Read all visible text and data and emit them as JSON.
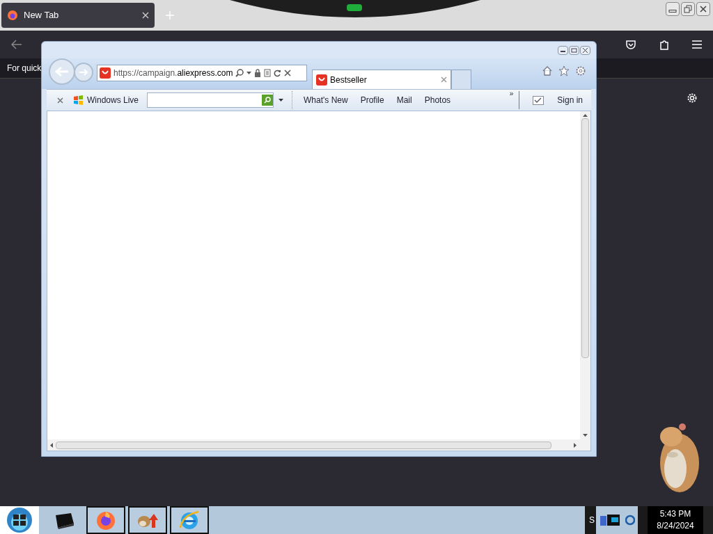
{
  "firefox": {
    "tabs": [
      {
        "label": "New Tab",
        "selected": true
      }
    ],
    "bookmarks_hint": "For quick"
  },
  "ie": {
    "address": {
      "prefix": "https://campaign.",
      "domain": "aliexpress.com"
    },
    "tabs": [
      {
        "label": "Bestseller",
        "selected": true
      }
    ],
    "command_bar": {
      "brand": "Windows Live",
      "links": [
        "What's New",
        "Profile",
        "Mail",
        "Photos"
      ],
      "overflow": "»",
      "sign_in": "Sign in"
    }
  },
  "taskbar": {
    "apps": [
      {
        "kind": "printer",
        "selected": false
      },
      {
        "kind": "firefox",
        "selected": true
      },
      {
        "kind": "pet",
        "selected": true
      },
      {
        "kind": "ie",
        "selected": true
      }
    ],
    "tray_letter": "S",
    "time": "5:43 PM",
    "date": "8/24/2024"
  }
}
